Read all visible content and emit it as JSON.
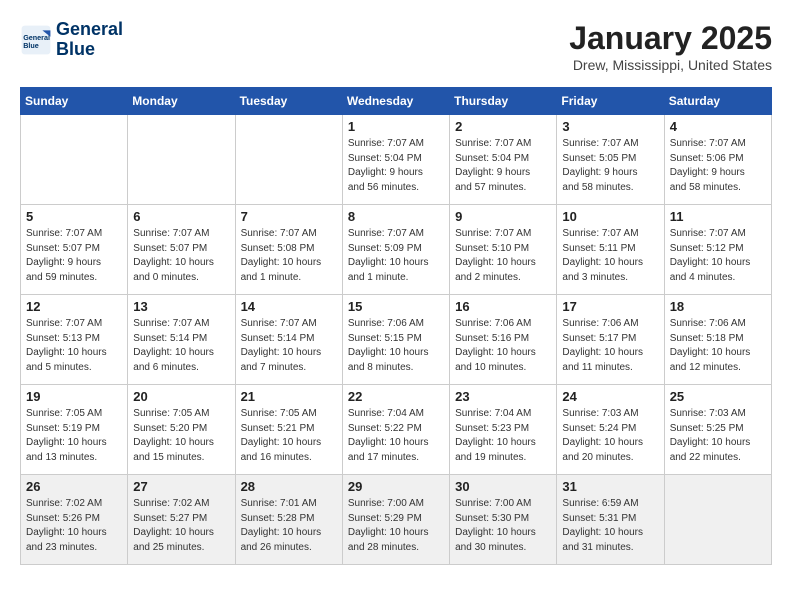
{
  "header": {
    "logo_line1": "General",
    "logo_line2": "Blue",
    "month": "January 2025",
    "location": "Drew, Mississippi, United States"
  },
  "weekdays": [
    "Sunday",
    "Monday",
    "Tuesday",
    "Wednesday",
    "Thursday",
    "Friday",
    "Saturday"
  ],
  "weeks": [
    [
      {
        "day": "",
        "info": ""
      },
      {
        "day": "",
        "info": ""
      },
      {
        "day": "",
        "info": ""
      },
      {
        "day": "1",
        "info": "Sunrise: 7:07 AM\nSunset: 5:04 PM\nDaylight: 9 hours\nand 56 minutes."
      },
      {
        "day": "2",
        "info": "Sunrise: 7:07 AM\nSunset: 5:04 PM\nDaylight: 9 hours\nand 57 minutes."
      },
      {
        "day": "3",
        "info": "Sunrise: 7:07 AM\nSunset: 5:05 PM\nDaylight: 9 hours\nand 58 minutes."
      },
      {
        "day": "4",
        "info": "Sunrise: 7:07 AM\nSunset: 5:06 PM\nDaylight: 9 hours\nand 58 minutes."
      }
    ],
    [
      {
        "day": "5",
        "info": "Sunrise: 7:07 AM\nSunset: 5:07 PM\nDaylight: 9 hours\nand 59 minutes."
      },
      {
        "day": "6",
        "info": "Sunrise: 7:07 AM\nSunset: 5:07 PM\nDaylight: 10 hours\nand 0 minutes."
      },
      {
        "day": "7",
        "info": "Sunrise: 7:07 AM\nSunset: 5:08 PM\nDaylight: 10 hours\nand 1 minute."
      },
      {
        "day": "8",
        "info": "Sunrise: 7:07 AM\nSunset: 5:09 PM\nDaylight: 10 hours\nand 1 minute."
      },
      {
        "day": "9",
        "info": "Sunrise: 7:07 AM\nSunset: 5:10 PM\nDaylight: 10 hours\nand 2 minutes."
      },
      {
        "day": "10",
        "info": "Sunrise: 7:07 AM\nSunset: 5:11 PM\nDaylight: 10 hours\nand 3 minutes."
      },
      {
        "day": "11",
        "info": "Sunrise: 7:07 AM\nSunset: 5:12 PM\nDaylight: 10 hours\nand 4 minutes."
      }
    ],
    [
      {
        "day": "12",
        "info": "Sunrise: 7:07 AM\nSunset: 5:13 PM\nDaylight: 10 hours\nand 5 minutes."
      },
      {
        "day": "13",
        "info": "Sunrise: 7:07 AM\nSunset: 5:14 PM\nDaylight: 10 hours\nand 6 minutes."
      },
      {
        "day": "14",
        "info": "Sunrise: 7:07 AM\nSunset: 5:14 PM\nDaylight: 10 hours\nand 7 minutes."
      },
      {
        "day": "15",
        "info": "Sunrise: 7:06 AM\nSunset: 5:15 PM\nDaylight: 10 hours\nand 8 minutes."
      },
      {
        "day": "16",
        "info": "Sunrise: 7:06 AM\nSunset: 5:16 PM\nDaylight: 10 hours\nand 10 minutes."
      },
      {
        "day": "17",
        "info": "Sunrise: 7:06 AM\nSunset: 5:17 PM\nDaylight: 10 hours\nand 11 minutes."
      },
      {
        "day": "18",
        "info": "Sunrise: 7:06 AM\nSunset: 5:18 PM\nDaylight: 10 hours\nand 12 minutes."
      }
    ],
    [
      {
        "day": "19",
        "info": "Sunrise: 7:05 AM\nSunset: 5:19 PM\nDaylight: 10 hours\nand 13 minutes."
      },
      {
        "day": "20",
        "info": "Sunrise: 7:05 AM\nSunset: 5:20 PM\nDaylight: 10 hours\nand 15 minutes."
      },
      {
        "day": "21",
        "info": "Sunrise: 7:05 AM\nSunset: 5:21 PM\nDaylight: 10 hours\nand 16 minutes."
      },
      {
        "day": "22",
        "info": "Sunrise: 7:04 AM\nSunset: 5:22 PM\nDaylight: 10 hours\nand 17 minutes."
      },
      {
        "day": "23",
        "info": "Sunrise: 7:04 AM\nSunset: 5:23 PM\nDaylight: 10 hours\nand 19 minutes."
      },
      {
        "day": "24",
        "info": "Sunrise: 7:03 AM\nSunset: 5:24 PM\nDaylight: 10 hours\nand 20 minutes."
      },
      {
        "day": "25",
        "info": "Sunrise: 7:03 AM\nSunset: 5:25 PM\nDaylight: 10 hours\nand 22 minutes."
      }
    ],
    [
      {
        "day": "26",
        "info": "Sunrise: 7:02 AM\nSunset: 5:26 PM\nDaylight: 10 hours\nand 23 minutes."
      },
      {
        "day": "27",
        "info": "Sunrise: 7:02 AM\nSunset: 5:27 PM\nDaylight: 10 hours\nand 25 minutes."
      },
      {
        "day": "28",
        "info": "Sunrise: 7:01 AM\nSunset: 5:28 PM\nDaylight: 10 hours\nand 26 minutes."
      },
      {
        "day": "29",
        "info": "Sunrise: 7:00 AM\nSunset: 5:29 PM\nDaylight: 10 hours\nand 28 minutes."
      },
      {
        "day": "30",
        "info": "Sunrise: 7:00 AM\nSunset: 5:30 PM\nDaylight: 10 hours\nand 30 minutes."
      },
      {
        "day": "31",
        "info": "Sunrise: 6:59 AM\nSunset: 5:31 PM\nDaylight: 10 hours\nand 31 minutes."
      },
      {
        "day": "",
        "info": ""
      }
    ]
  ]
}
